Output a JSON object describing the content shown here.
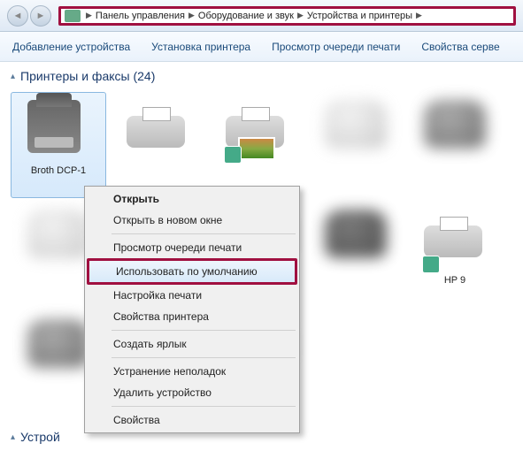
{
  "breadcrumb": {
    "items": [
      "Панель управления",
      "Оборудование и звук",
      "Устройства и принтеры"
    ]
  },
  "toolbar": {
    "add_device": "Добавление устройства",
    "add_printer": "Установка принтера",
    "view_queue": "Просмотр очереди печати",
    "server_props": "Свойства серве"
  },
  "sections": {
    "printers_title": "Принтеры и факсы (24)",
    "devices_title": "Устрой"
  },
  "devices": {
    "d0": "Broth\nDCP-1",
    "d1": "HP 9"
  },
  "context_menu": {
    "open": "Открыть",
    "open_new": "Открыть в новом окне",
    "view_queue": "Просмотр очереди печати",
    "set_default": "Использовать по умолчанию",
    "print_prefs": "Настройка печати",
    "printer_props": "Свойства принтера",
    "create_shortcut": "Создать ярлык",
    "troubleshoot": "Устранение неполадок",
    "remove": "Удалить устройство",
    "properties": "Свойства"
  }
}
